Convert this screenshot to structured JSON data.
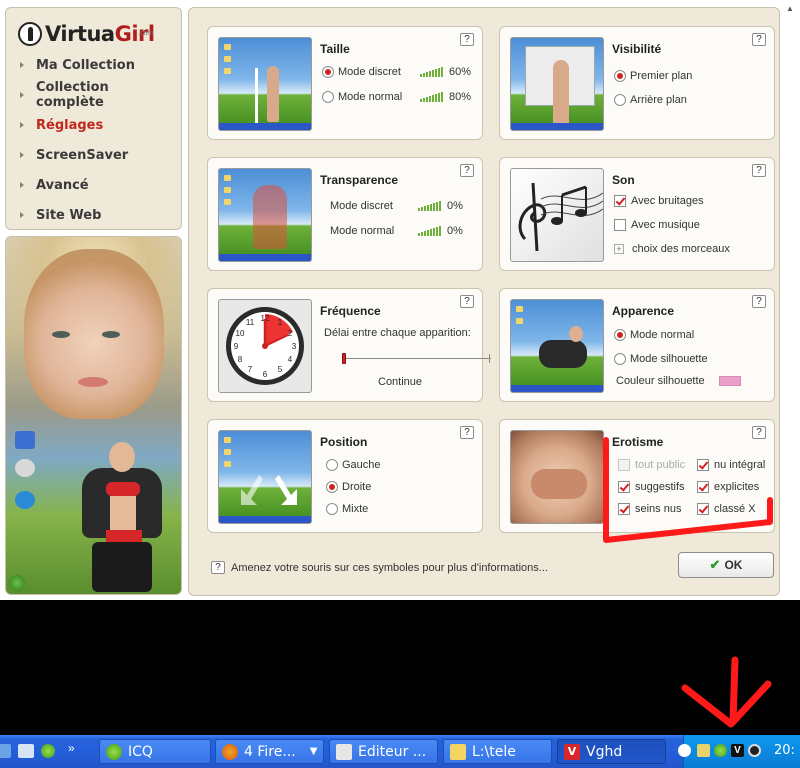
{
  "app": {
    "logo": "VirtuaGirl",
    "logo_suffix": ".com"
  },
  "sidebar": {
    "items": [
      {
        "label": "Ma Collection"
      },
      {
        "label": "Collection complète"
      },
      {
        "label": "Réglages",
        "active": true
      },
      {
        "label": "ScreenSaver"
      },
      {
        "label": "Avancé"
      },
      {
        "label": "Site Web"
      }
    ],
    "desktop_icons": [
      "ICQ module",
      "Mises à jour"
    ]
  },
  "cards": {
    "taille": {
      "title": "Taille",
      "help": "?",
      "options": [
        {
          "label": "Mode discret",
          "selected": true,
          "value": "60%"
        },
        {
          "label": "Mode normal",
          "selected": false,
          "value": "80%"
        }
      ]
    },
    "visibilite": {
      "title": "Visibilité",
      "help": "?",
      "options": [
        {
          "label": "Premier plan",
          "selected": true
        },
        {
          "label": "Arrière plan",
          "selected": false
        }
      ]
    },
    "transparence": {
      "title": "Transparence",
      "help": "?",
      "rows": [
        {
          "label": "Mode discret",
          "value": "0%"
        },
        {
          "label": "Mode normal",
          "value": "0%"
        }
      ]
    },
    "son": {
      "title": "Son",
      "help": "?",
      "options": [
        {
          "label": "Avec bruitages",
          "checked": true
        },
        {
          "label": "Avec musique",
          "checked": false
        }
      ],
      "choose": "choix des morceaux"
    },
    "frequence": {
      "title": "Fréquence",
      "help": "?",
      "description": "Délai entre chaque apparition:",
      "value_label": "Continue",
      "slider_level": 0
    },
    "apparence": {
      "title": "Apparence",
      "help": "?",
      "options": [
        {
          "label": "Mode normal",
          "selected": true
        },
        {
          "label": "Mode silhouette",
          "selected": false
        }
      ],
      "color_label": "Couleur silhouette",
      "silhouette_color": "#e8a0c8"
    },
    "position": {
      "title": "Position",
      "help": "?",
      "options": [
        {
          "label": "Gauche",
          "selected": false
        },
        {
          "label": "Droite",
          "selected": true
        },
        {
          "label": "Mixte",
          "selected": false
        }
      ]
    },
    "erotisme": {
      "title": "Erotisme",
      "help": "?",
      "options": [
        {
          "label": "tout public",
          "checked": false,
          "disabled": true
        },
        {
          "label": "nu intégral",
          "checked": true
        },
        {
          "label": "suggestifs",
          "checked": true
        },
        {
          "label": "explicites",
          "checked": true
        },
        {
          "label": "seins nus",
          "checked": true
        },
        {
          "label": "classé X",
          "checked": true
        }
      ]
    }
  },
  "footer": {
    "help": "?",
    "info_text": "Amenez votre souris sur ces symboles pour plus d'informations...",
    "ok_label": "OK"
  },
  "taskbar": {
    "chevron": "»",
    "items": [
      {
        "label": "ICQ"
      },
      {
        "label": "4 Fire..."
      },
      {
        "label": "Editeur ..."
      },
      {
        "label": "L:\\tele"
      },
      {
        "label": "Vghd",
        "active": true
      }
    ],
    "clock": "20:"
  },
  "colors": {
    "accent": "#c0281e",
    "panel": "#efe9d9",
    "taskbar": "#245edb",
    "annotation": "#ff0000"
  }
}
